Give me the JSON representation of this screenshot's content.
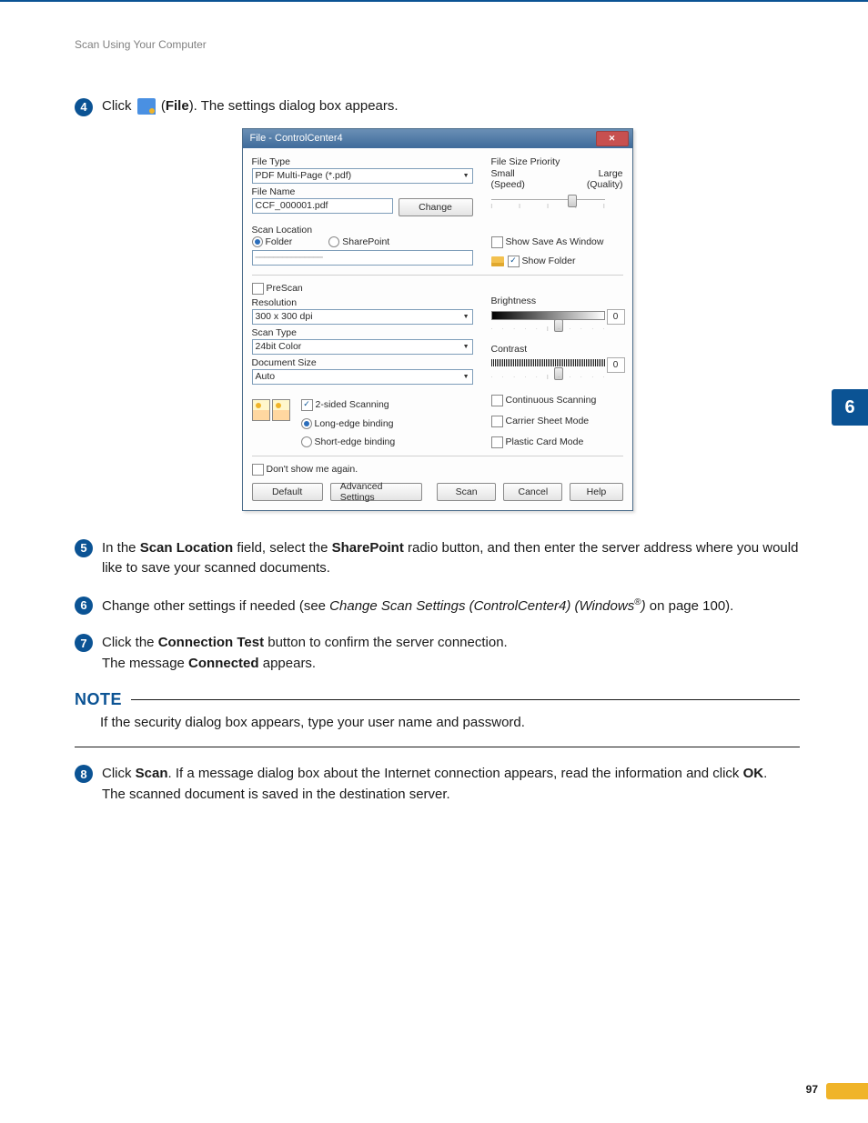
{
  "breadcrumb": "Scan Using Your Computer",
  "tab": "6",
  "page_number": "97",
  "steps": {
    "s4_a": "Click ",
    "s4_b": " (",
    "s4_c": "File",
    "s4_d": "). The settings dialog box appears.",
    "s5_a": "In the ",
    "s5_b": "Scan Location",
    "s5_c": " field, select the ",
    "s5_d": "SharePoint",
    "s5_e": " radio button, and then enter the server address where you would like to save your scanned documents.",
    "s6_a": "Change other settings if needed (see ",
    "s6_b": "Change Scan Settings (ControlCenter4) (Windows",
    "s6_c": ")",
    "s6_d": " on page 100).",
    "s7_a": "Click the ",
    "s7_b": "Connection Test",
    "s7_c": " button to confirm the server connection.",
    "s7_d": "The message ",
    "s7_e": "Connected",
    "s7_f": " appears.",
    "s8_a": "Click ",
    "s8_b": "Scan",
    "s8_c": ". If a message dialog box about the Internet connection appears, read the information and click ",
    "s8_d": "OK",
    "s8_e": ".",
    "s8_f": "The scanned document is saved in the destination server."
  },
  "note_label": "NOTE",
  "note_text": "If the security dialog box appears, type your user name and password.",
  "dialog": {
    "title": "File - ControlCenter4",
    "labels": {
      "file_type": "File Type",
      "file_name": "File Name",
      "scan_location": "Scan Location",
      "folder": "Folder",
      "sharepoint": "SharePoint",
      "show_save_as": "Show Save As Window",
      "show_folder": "Show Folder",
      "prescan": "PreScan",
      "resolution": "Resolution",
      "scan_type": "Scan Type",
      "document_size": "Document Size",
      "brightness": "Brightness",
      "contrast": "Contrast",
      "file_size_priority": "File Size Priority",
      "small": "Small",
      "large": "Large",
      "speed": "(Speed)",
      "quality": "(Quality)",
      "two_sided": "2-sided Scanning",
      "long_edge": "Long-edge binding",
      "short_edge": "Short-edge binding",
      "continuous": "Continuous Scanning",
      "carrier": "Carrier Sheet Mode",
      "plastic": "Plastic Card Mode",
      "dont_show": "Don't show me again."
    },
    "values": {
      "file_type": "PDF Multi-Page (*.pdf)",
      "file_name": "CCF_000001.pdf",
      "resolution": "300 x 300 dpi",
      "scan_type": "24bit Color",
      "document_size": "Auto",
      "brightness": "0",
      "contrast": "0"
    },
    "buttons": {
      "change": "Change",
      "default": "Default",
      "advanced": "Advanced Settings",
      "scan": "Scan",
      "cancel": "Cancel",
      "help": "Help"
    }
  }
}
